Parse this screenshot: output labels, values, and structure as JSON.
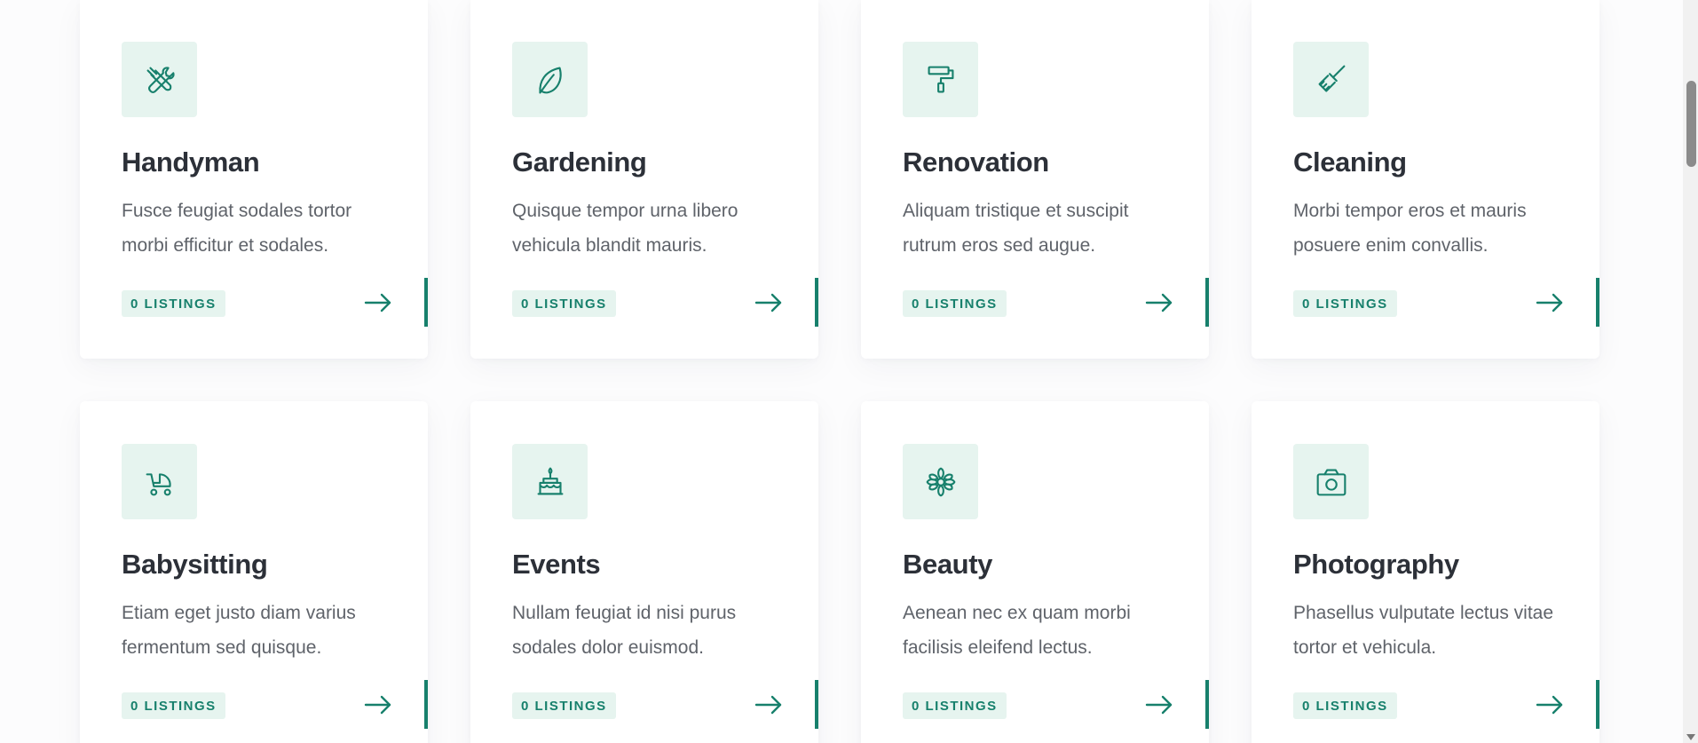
{
  "categories": [
    {
      "title": "Handyman",
      "description": "Fusce feugiat sodales tortor morbi efficitur et sodales.",
      "listings_label": "0 LISTINGS",
      "icon": "tools-icon"
    },
    {
      "title": "Gardening",
      "description": "Quisque tempor urna libero vehicula blandit mauris.",
      "listings_label": "0 LISTINGS",
      "icon": "leaf-icon"
    },
    {
      "title": "Renovation",
      "description": "Aliquam tristique et suscipit rutrum eros sed augue.",
      "listings_label": "0 LISTINGS",
      "icon": "paint-roller-icon"
    },
    {
      "title": "Cleaning",
      "description": "Morbi tempor eros et mauris posuere enim convallis.",
      "listings_label": "0 LISTINGS",
      "icon": "broom-icon"
    },
    {
      "title": "Babysitting",
      "description": "Etiam eget justo diam varius fermentum sed quisque.",
      "listings_label": "0 LISTINGS",
      "icon": "baby-carriage-icon"
    },
    {
      "title": "Events",
      "description": "Nullam feugiat id nisi purus sodales dolor euismod.",
      "listings_label": "0 LISTINGS",
      "icon": "cake-icon"
    },
    {
      "title": "Beauty",
      "description": "Aenean nec ex quam morbi facilisis eleifend lectus.",
      "listings_label": "0 LISTINGS",
      "icon": "flower-icon"
    },
    {
      "title": "Photography",
      "description": "Phasellus vulputate lectus vitae tortor et vehicula.",
      "listings_label": "0 LISTINGS",
      "icon": "camera-icon"
    }
  ],
  "colors": {
    "accent": "#17806c",
    "icon_background": "#e6f4ef",
    "heading": "#2c3038",
    "body_text": "#5f636a"
  }
}
